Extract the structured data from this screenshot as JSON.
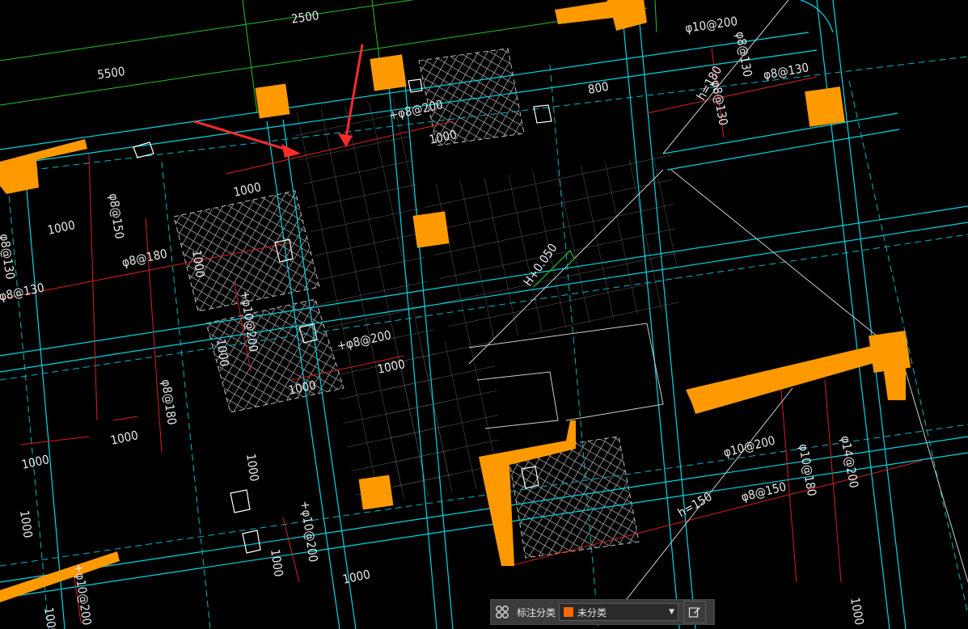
{
  "drawing": {
    "dimensions": {
      "top": "2500",
      "left": "5500"
    },
    "labels": [
      "φ10@200",
      "φ8@130",
      "φ8@130",
      "h=180",
      "φ8@130",
      "800",
      "+φ8@200",
      "1000",
      "φ8@150",
      "1000",
      "φ8@130",
      "φ8@180",
      "1000",
      "1000",
      "φ8@130",
      "+φ10@200",
      "1000",
      "+φ8@200",
      "1000",
      "1000",
      "φ8@180",
      "1000",
      "1000",
      "H+0.050",
      "φ10@200",
      "φ10@180",
      "φ14@200",
      "φ8@150",
      "h=150",
      "1000",
      "+φ10@200",
      "1000",
      "1000",
      "1000",
      "+φ10@200",
      "1000",
      "1000"
    ]
  },
  "toolbar": {
    "label": "标注分类",
    "selected": "未分类",
    "swatch_color": "#ff6a00"
  },
  "colors": {
    "column": "#ff9900",
    "wall_cyan": "#00d8e6",
    "grid_green": "#22c522",
    "dim_red": "#d82020",
    "arrow_red": "#ff2a2a",
    "text": "#e8e8e8"
  }
}
